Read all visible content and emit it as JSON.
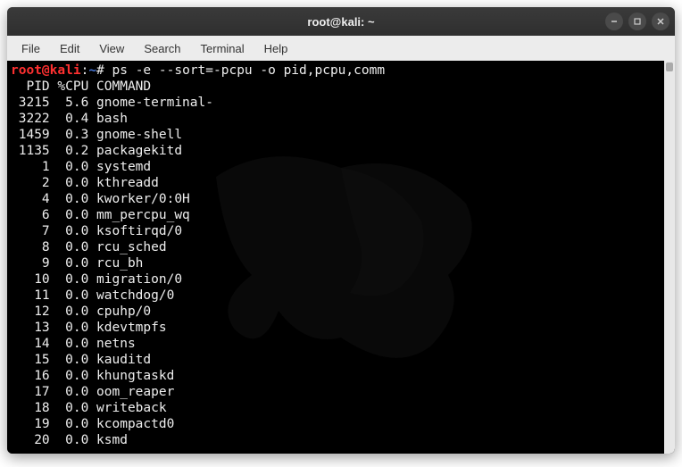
{
  "window": {
    "title": "root@kali: ~"
  },
  "menubar": {
    "items": [
      "File",
      "Edit",
      "View",
      "Search",
      "Terminal",
      "Help"
    ]
  },
  "prompt": {
    "user_host": "root@kali",
    "colon": ":",
    "path": "~",
    "hash": "#"
  },
  "command": "ps -e --sort=-pcpu -o pid,pcpu,comm",
  "output": {
    "header": "  PID %CPU COMMAND",
    "rows": [
      {
        "pid": "3215",
        "cpu": "5.6",
        "cmd": "gnome-terminal-"
      },
      {
        "pid": "3222",
        "cpu": "0.4",
        "cmd": "bash"
      },
      {
        "pid": "1459",
        "cpu": "0.3",
        "cmd": "gnome-shell"
      },
      {
        "pid": "1135",
        "cpu": "0.2",
        "cmd": "packagekitd"
      },
      {
        "pid": "1",
        "cpu": "0.0",
        "cmd": "systemd"
      },
      {
        "pid": "2",
        "cpu": "0.0",
        "cmd": "kthreadd"
      },
      {
        "pid": "4",
        "cpu": "0.0",
        "cmd": "kworker/0:0H"
      },
      {
        "pid": "6",
        "cpu": "0.0",
        "cmd": "mm_percpu_wq"
      },
      {
        "pid": "7",
        "cpu": "0.0",
        "cmd": "ksoftirqd/0"
      },
      {
        "pid": "8",
        "cpu": "0.0",
        "cmd": "rcu_sched"
      },
      {
        "pid": "9",
        "cpu": "0.0",
        "cmd": "rcu_bh"
      },
      {
        "pid": "10",
        "cpu": "0.0",
        "cmd": "migration/0"
      },
      {
        "pid": "11",
        "cpu": "0.0",
        "cmd": "watchdog/0"
      },
      {
        "pid": "12",
        "cpu": "0.0",
        "cmd": "cpuhp/0"
      },
      {
        "pid": "13",
        "cpu": "0.0",
        "cmd": "kdevtmpfs"
      },
      {
        "pid": "14",
        "cpu": "0.0",
        "cmd": "netns"
      },
      {
        "pid": "15",
        "cpu": "0.0",
        "cmd": "kauditd"
      },
      {
        "pid": "16",
        "cpu": "0.0",
        "cmd": "khungtaskd"
      },
      {
        "pid": "17",
        "cpu": "0.0",
        "cmd": "oom_reaper"
      },
      {
        "pid": "18",
        "cpu": "0.0",
        "cmd": "writeback"
      },
      {
        "pid": "19",
        "cpu": "0.0",
        "cmd": "kcompactd0"
      },
      {
        "pid": "20",
        "cpu": "0.0",
        "cmd": "ksmd"
      }
    ]
  }
}
